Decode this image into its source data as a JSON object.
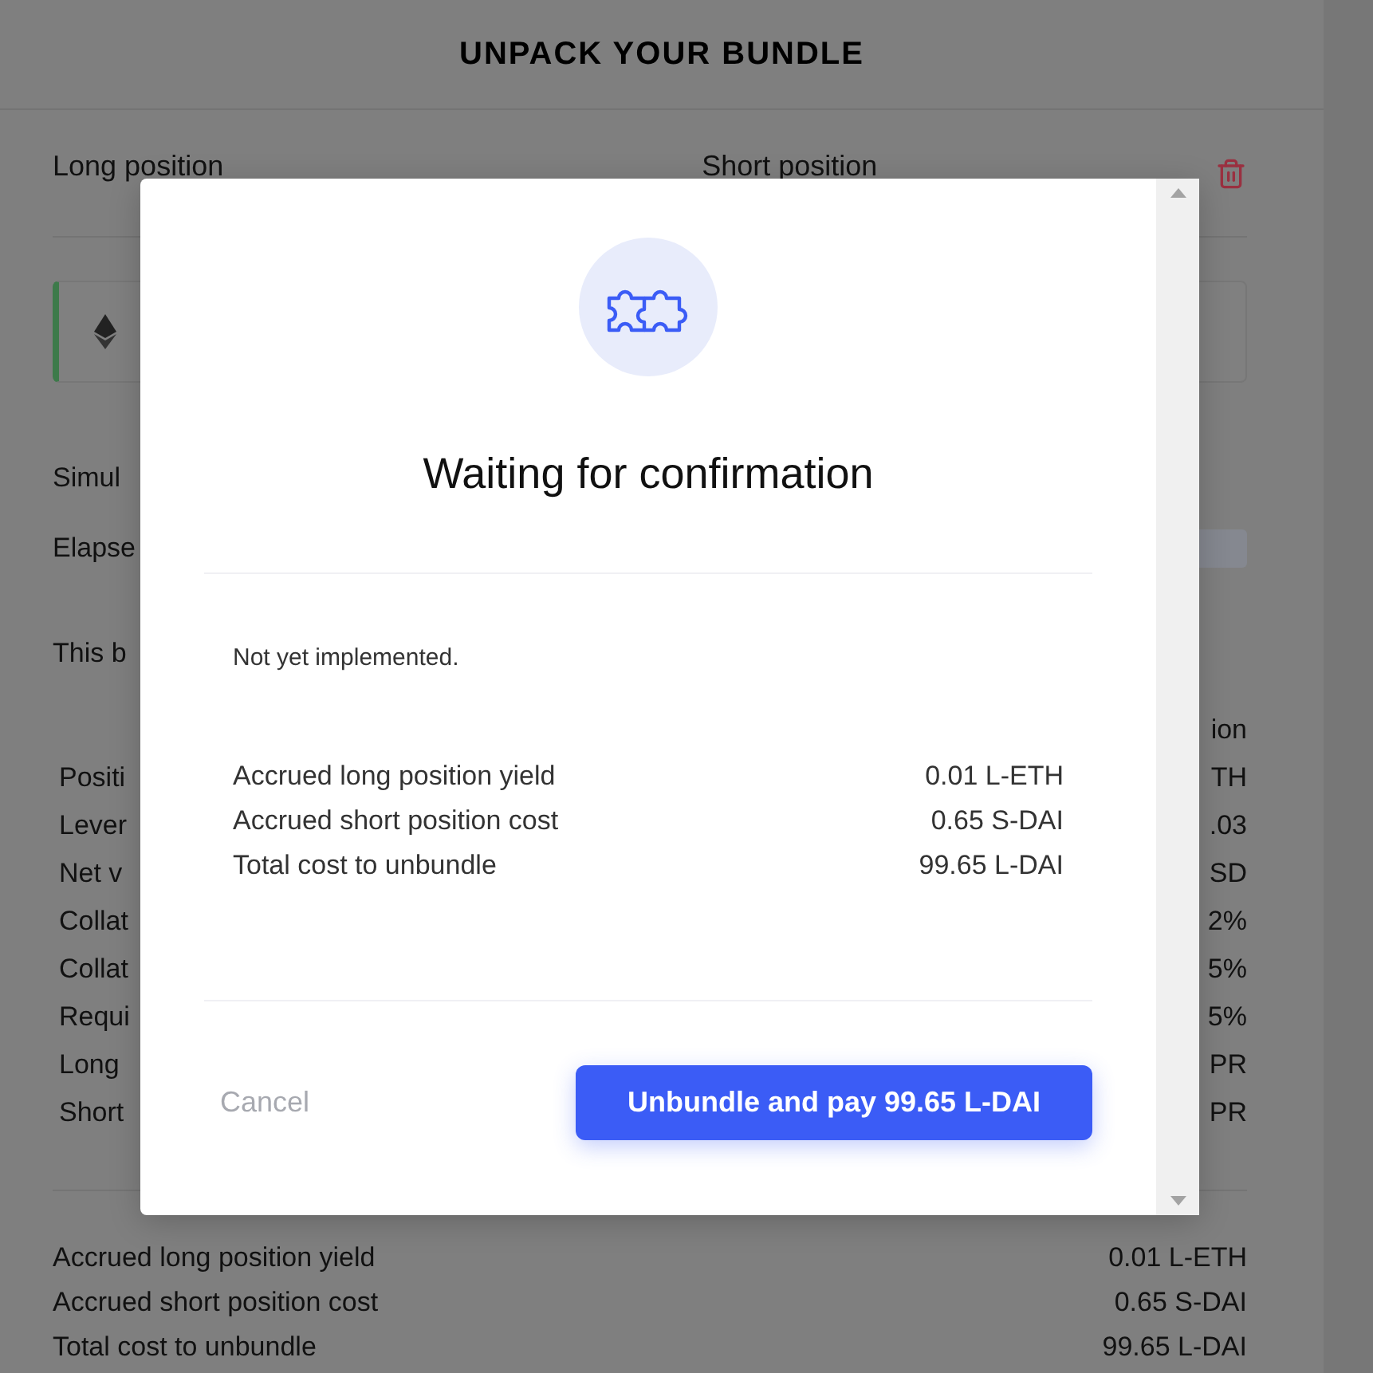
{
  "page": {
    "title": "UNPACK YOUR BUNDLE",
    "position_headers": [
      "Long position",
      "Short position"
    ],
    "simulation_label": "Simul",
    "elapsed_label": "Elapse",
    "description": "This b",
    "table_header": "ion",
    "table_rows": [
      {
        "label": "Positi",
        "value": "TH"
      },
      {
        "label": "Lever",
        "value": ".03"
      },
      {
        "label": "Net v",
        "value": "SD"
      },
      {
        "label": "Collat",
        "value": "2%"
      },
      {
        "label": "Collat",
        "value": "5%"
      },
      {
        "label": "Requi",
        "value": "5%"
      },
      {
        "label": "Long",
        "value": "PR"
      },
      {
        "label": "Short",
        "value": "PR"
      }
    ],
    "summary": [
      {
        "label": "Accrued long position yield",
        "value": "0.01 L-ETH"
      },
      {
        "label": "Accrued short position cost",
        "value": "0.65 S-DAI"
      },
      {
        "label": "Total cost to unbundle",
        "value": "99.65 L-DAI"
      }
    ]
  },
  "modal": {
    "title": "Waiting for confirmation",
    "message": "Not yet implemented.",
    "rows": [
      {
        "label": "Accrued long position yield",
        "value": "0.01 L-ETH"
      },
      {
        "label": "Accrued short position cost",
        "value": "0.65 S-DAI"
      },
      {
        "label": "Total cost to unbundle",
        "value": "99.65 L-DAI"
      }
    ],
    "cancel": "Cancel",
    "confirm": "Unbundle and pay 99.65 L-DAI"
  }
}
